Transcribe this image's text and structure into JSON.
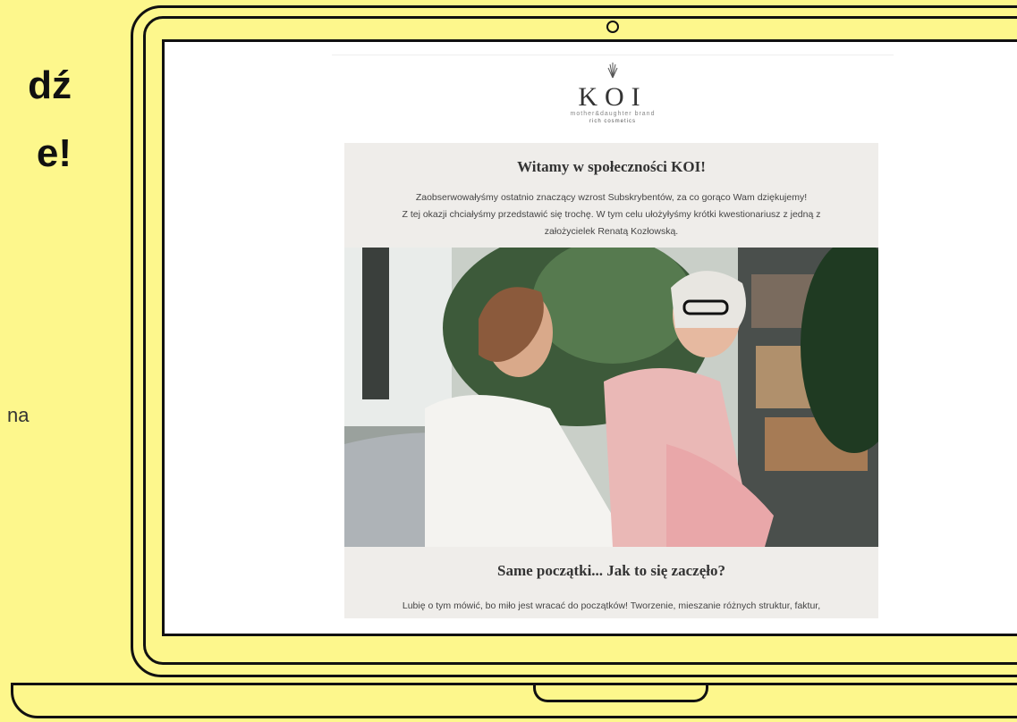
{
  "promo": {
    "headline_line1": "dź",
    "headline_line2": "e!",
    "side_fragment": "na"
  },
  "email": {
    "logo": {
      "brand": "KOI",
      "tagline": "mother&daughter brand",
      "subline": "rich cosmetics"
    },
    "welcome_title": "Witamy w społeczności KOI!",
    "welcome_lines": [
      "Zaobserwowałyśmy ostatnio znaczący wzrost Subskrybentów, za co gorąco Wam dziękujemy!",
      "Z tej okazji chciałyśmy przedstawić się trochę. W tym celu ułożyłyśmy krótki kwestionariusz z jedną z",
      "założycielek Renatą Kozłowską."
    ],
    "section_title": "Same początki... Jak to się zaczęło?",
    "section_text": "Lubię o tym mówić, bo miło jest wracać do początków! Tworzenie, mieszanie różnych struktur, faktur,"
  },
  "colors": {
    "background": "#fdf78c",
    "card": "#efedea"
  }
}
